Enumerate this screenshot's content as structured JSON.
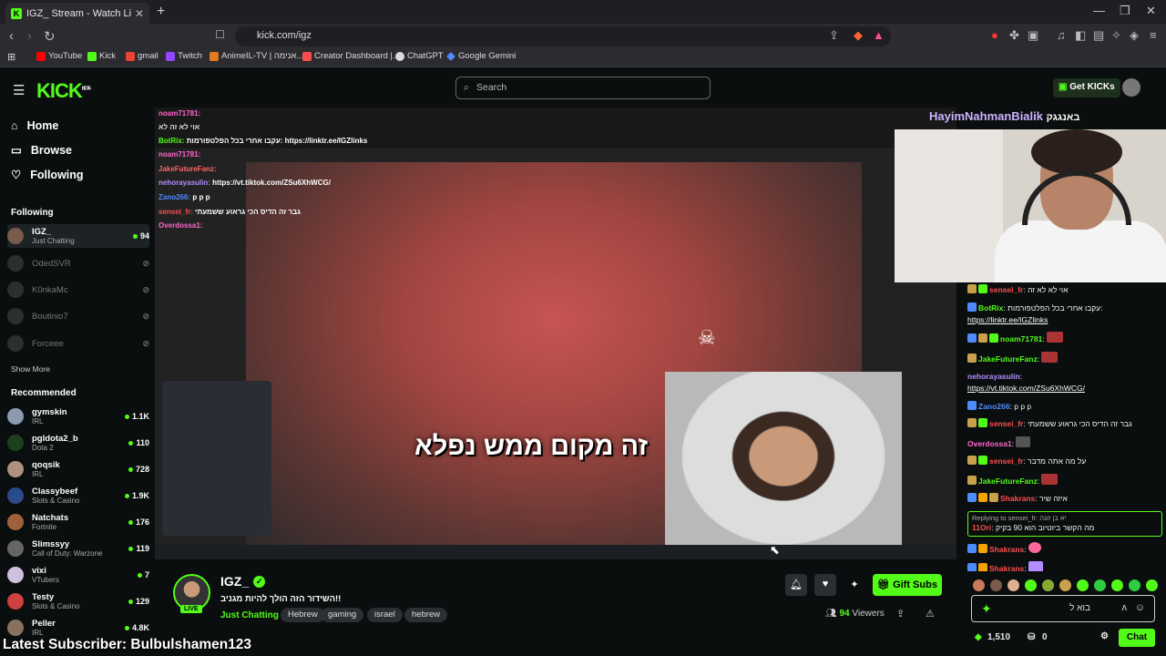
{
  "browser": {
    "tab_title": "IGZ_ Stream - Watch Live on K",
    "url": "kick.com/igz",
    "bookmarks": [
      {
        "label": "YouTube",
        "color": "#ff0000"
      },
      {
        "label": "Kick",
        "color": "#53fc18"
      },
      {
        "label": "gmail",
        "color": "#ea4335"
      },
      {
        "label": "Twitch",
        "color": "#9146ff"
      },
      {
        "label": "AnimeIL-TV | אנימה...",
        "color": "#e07a1f"
      },
      {
        "label": "Creator Dashboard |...",
        "color": "#ff4d4d"
      },
      {
        "label": "ChatGPT",
        "color": "#dddddd"
      },
      {
        "label": "Google Gemini",
        "color": "#4d8bff"
      }
    ]
  },
  "header": {
    "logo": "KICK",
    "logo_sup": "BETA",
    "search_placeholder": "Search",
    "get_kicks": "Get KICKs"
  },
  "sidebar": {
    "nav": [
      {
        "label": "Home",
        "icon": "home-icon"
      },
      {
        "label": "Browse",
        "icon": "browse-icon"
      },
      {
        "label": "Following",
        "icon": "heart-icon"
      }
    ],
    "following_title": "Following",
    "following": [
      {
        "name": "IGZ_",
        "category": "Just Chatting",
        "viewers": "94",
        "live": true
      },
      {
        "name": "OdedSVR",
        "category": "",
        "viewers": "",
        "live": false
      },
      {
        "name": "K0nkaMc",
        "category": "",
        "viewers": "",
        "live": false
      },
      {
        "name": "Boutinio7",
        "category": "",
        "viewers": "",
        "live": false
      },
      {
        "name": "Forceee",
        "category": "",
        "viewers": "",
        "live": false
      }
    ],
    "show_more": "Show More",
    "recommended_title": "Recommended",
    "recommended": [
      {
        "name": "gymskin",
        "category": "IRL",
        "viewers": "1.1K"
      },
      {
        "name": "pgldota2_b",
        "category": "Dota 2",
        "viewers": "110"
      },
      {
        "name": "qoqsik",
        "category": "IRL",
        "viewers": "728"
      },
      {
        "name": "Classybeef",
        "category": "Slots & Casino",
        "viewers": "1.9K"
      },
      {
        "name": "Natchats",
        "category": "Fortnite",
        "viewers": "176"
      },
      {
        "name": "Slimssyy",
        "category": "Call of Duty: Warzone",
        "viewers": "119"
      },
      {
        "name": "vixi",
        "category": "VTubers",
        "viewers": "7"
      },
      {
        "name": "Testy",
        "category": "Slots & Casino",
        "viewers": "129"
      },
      {
        "name": "Peller",
        "category": "IRL",
        "viewers": "4.8K"
      }
    ]
  },
  "video": {
    "caption": "זה מקום ממש נפלא",
    "overlay_chat": [
      {
        "user": "noam71781:",
        "text": "",
        "color": "#ff66cc"
      },
      {
        "user": "",
        "text": "אוי לא זה לא",
        "color": "#ff6666"
      },
      {
        "user": "BotRix:",
        "text": "עקבו אחרי בכל הפלטפורמות: https://linktr.ee/IGZlinks",
        "color": "#53fc18"
      },
      {
        "user": "noam71781:",
        "text": "",
        "color": "#ff66cc"
      },
      {
        "user": "JakeFutureFanz:",
        "text": "",
        "color": "#ff6666"
      },
      {
        "user": "nehorayasulin:",
        "text": "https://vt.tiktok.com/ZSu6XhWCG/",
        "color": "#b28dff"
      },
      {
        "user": "Zano266:",
        "text": "p p p",
        "color": "#4d8bff"
      },
      {
        "user": "sensei_fr:",
        "text": "גבר זה הדיס הכי גראוע ששמעתי",
        "color": "#ff4d4d"
      },
      {
        "user": "Overdossa1:",
        "text": "",
        "color": "#ff66cc"
      }
    ],
    "latest_subscriber": "Latest Subscriber: Bulbulshamen123"
  },
  "stream": {
    "streamer": "IGZ_",
    "live_label": "LIVE",
    "title": "השידור הזה הולך להיות מגניב!!",
    "category": "Just Chatting",
    "tags": [
      "Hebrew",
      "gaming",
      "israel",
      "hebrew"
    ],
    "gift_subs": "Gift Subs",
    "viewers": "94",
    "viewers_label": "Viewers"
  },
  "chat": {
    "header_name": "HayimNahmanBialik",
    "header_text": "באנגגק",
    "messages": [
      {
        "user": "sensei_fr",
        "text": "אוי לא לא זה",
        "color": "#ff4d4d"
      },
      {
        "user": "BotRix",
        "text": "עקבו אחרי בכל הפלטפורמות:",
        "link": "https://linktr.ee/IGZlinks",
        "color": "#53fc18"
      },
      {
        "user": "noam71781",
        "text": "",
        "color": "#53fc18"
      },
      {
        "user": "JakeFutureFanz",
        "text": "",
        "color": "#53fc18"
      },
      {
        "user": "nehorayasulin",
        "text": "",
        "link": "https://vt.tiktok.com/ZSu6XhWCG/",
        "color": "#b28dff"
      },
      {
        "user": "Zano266",
        "text": "p p p",
        "color": "#4d8bff"
      },
      {
        "user": "sensei_fr",
        "text": "גבר זה הדיס הכי גראוע ששמעתי",
        "color": "#ff4d4d"
      },
      {
        "user": "Overdossa1",
        "text": "",
        "color": "#ff66cc"
      },
      {
        "user": "sensei_fr",
        "text": "על מה אתה מדבר",
        "color": "#ff4d4d"
      },
      {
        "user": "JakeFutureFanz",
        "text": "",
        "color": "#53fc18"
      },
      {
        "user": "Shakrans",
        "text": "איזה שיר",
        "color": "#ff4d4d"
      }
    ],
    "reply_to": "Replying to sensei_fr: יא בן זונה",
    "reply_user": "11Ori",
    "reply_text": "מה הקשר ביוטיוב הוא 90 בקיק",
    "tail_messages": [
      {
        "user": "Shakrans",
        "text": "",
        "color": "#ff4d4d"
      },
      {
        "user": "Shakrans",
        "text": "",
        "color": "#ff4d4d"
      }
    ],
    "input_value": "בוא ל",
    "kicks_balance": "1,510",
    "points": "0",
    "send_label": "Chat"
  }
}
